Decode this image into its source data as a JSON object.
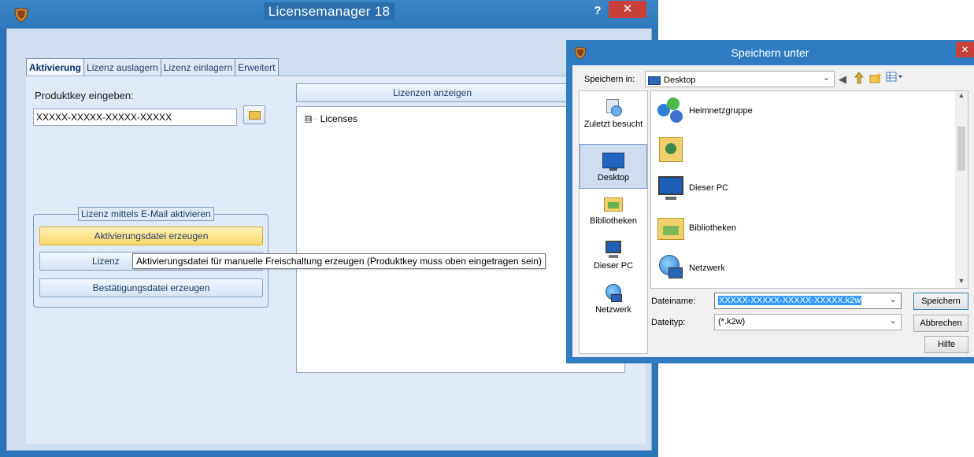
{
  "main_window": {
    "title": "Licensemanager 18",
    "help_label": "?",
    "close_label": "✕",
    "tabs": [
      {
        "label": "Aktivierung"
      },
      {
        "label": "Lizenz auslagern"
      },
      {
        "label": "Lizenz einlagern"
      },
      {
        "label": "Erweitert"
      }
    ],
    "product_key_label": "Produktkey eingeben:",
    "product_key_value": "XXXXX-XXXXX-XXXXX-XXXXX",
    "show_licenses_label": "Lizenzen anzeigen",
    "tree_root_label": "Licenses",
    "tree_expander": "⊟",
    "email_group_label": "Lizenz mittels E-Mail aktivieren",
    "btn_create_activation": "Aktivierungsdatei erzeugen",
    "btn_license_partial": "Lizenz",
    "btn_create_confirmation": "Bestätigungsdatei erzeugen",
    "tooltip_text": "Aktivierungsdatei für manuelle Freischaltung erzeugen (Produktkey muss oben eingetragen sein)"
  },
  "save_dialog": {
    "title": "Speichern unter",
    "close_label": "✕",
    "save_in_label": "Speichern in:",
    "save_in_value": "Desktop",
    "places": [
      {
        "label": "Zuletzt besucht",
        "icon": "recent-places-icon"
      },
      {
        "label": "Desktop",
        "icon": "desktop-icon"
      },
      {
        "label": "Bibliotheken",
        "icon": "libraries-icon"
      },
      {
        "label": "Dieser PC",
        "icon": "computer-icon"
      },
      {
        "label": "Netzwerk",
        "icon": "network-icon"
      }
    ],
    "files": [
      {
        "label": "Heimnetzgruppe",
        "icon": "homegroup-icon"
      },
      {
        "label": "",
        "icon": "user-folder-icon"
      },
      {
        "label": "Dieser PC",
        "icon": "computer-icon"
      },
      {
        "label": "Bibliotheken",
        "icon": "libraries-icon"
      },
      {
        "label": "Netzwerk",
        "icon": "network-icon"
      }
    ],
    "filename_label": "Dateiname:",
    "filename_value": "XXXXX-XXXXX-XXXXX-XXXXX.k2w",
    "filetype_label": "Dateityp:",
    "filetype_value": "(*.k2w)",
    "btn_save": "Speichern",
    "btn_cancel": "Abbrechen",
    "btn_help": "Hilfe"
  },
  "colors": {
    "title_bar": "#2f7cc2",
    "close_red": "#c7413a",
    "client_bg": "#dfeaf6",
    "hot_button": "#fcd86a",
    "selection": "#3399ff"
  }
}
